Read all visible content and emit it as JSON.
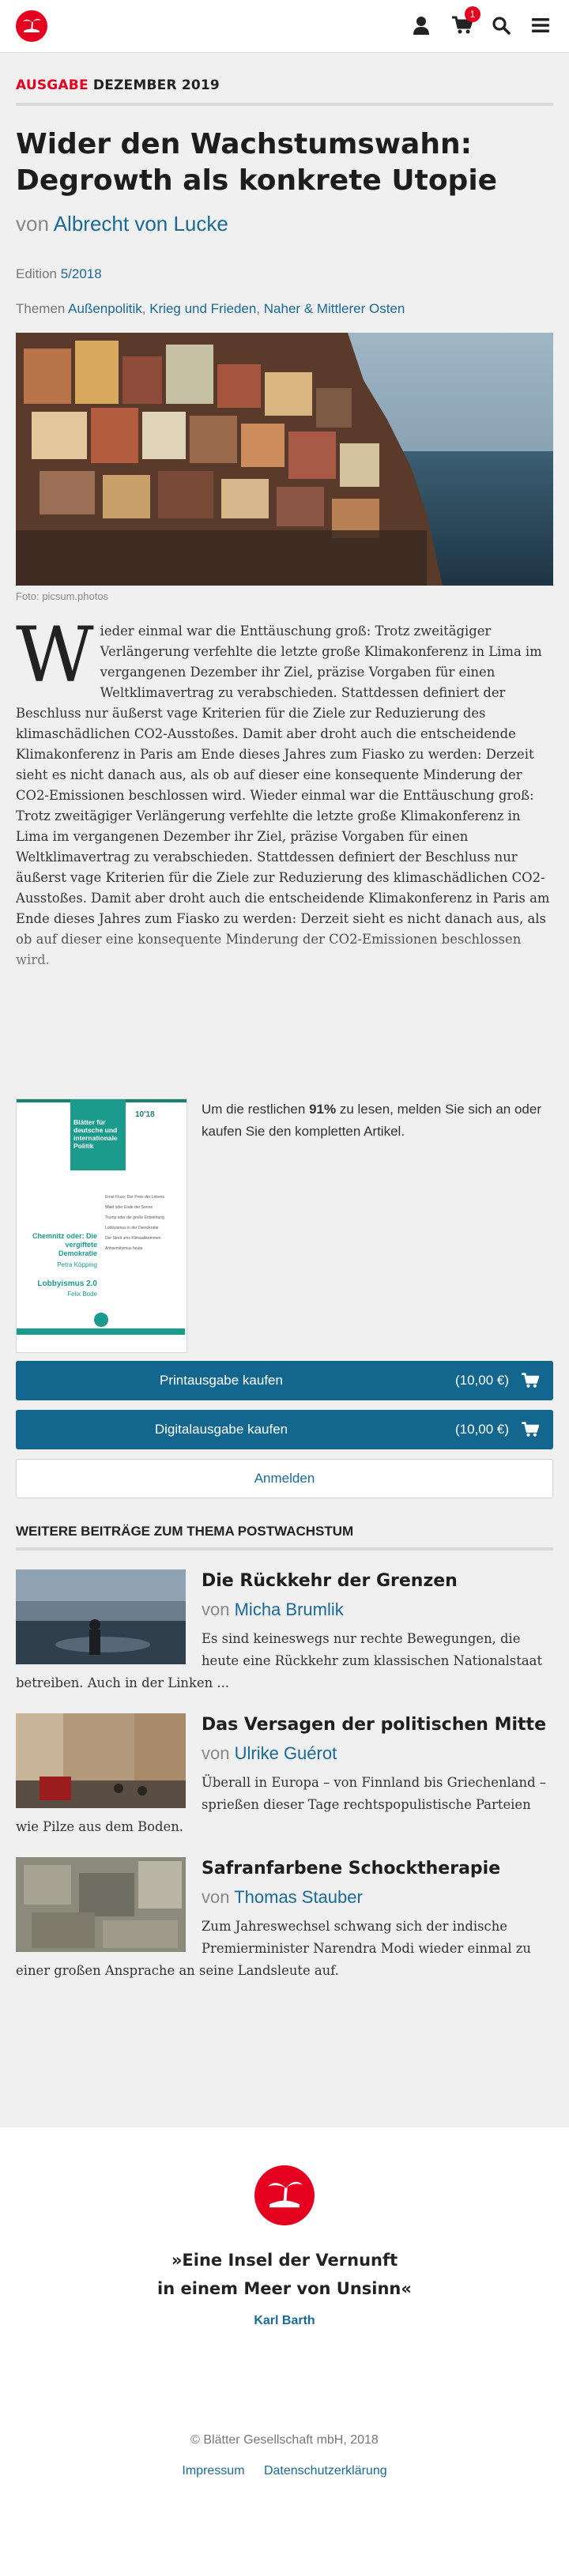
{
  "header": {
    "logo_icon": "island-logo-icon",
    "icons": [
      "user-icon",
      "cart-icon",
      "search-icon",
      "menu-icon"
    ],
    "cart_count": "1"
  },
  "article": {
    "kicker_red": "Ausgabe",
    "kicker_rest": "Dezember 2019",
    "title": "Wider den Wachstumswahn: Degrowth als konkrete Utopie",
    "author_prefix": "von",
    "author": "Albrecht von Lucke",
    "edition_label": "Edition",
    "edition_value": "5/2018",
    "themes_label": "Themen",
    "themes": [
      "Außenpolitik",
      "Krieg und Frieden",
      "Naher & Mittlerer Osten"
    ],
    "image_caption": "Foto: picsum.photos",
    "dropcap": "W",
    "body": "ieder einmal war die Enttäuschung groß: Trotz zweitägiger Verlängerung verfehlte die letzte große Klimakonferenz in Lima im vergangenen Dezember ihr Ziel, präzise Vorgaben für einen Weltklimavertrag zu verabschieden. Stattdessen definiert der Beschluss nur äußerst vage Kriterien für die Ziele zur Reduzierung des klimaschädlichen CO2-Ausstoßes. Damit aber droht auch die entscheidende Klimakonferenz in Paris am Ende dieses Jahres zum Fiasko zu werden: Derzeit sieht es nicht danach aus, als ob auf dieser eine konsequente Minderung der CO2-Emissionen beschlossen wird. Wieder einmal war die Enttäuschung groß: Trotz zweitägiger Verlängerung verfehlte die letzte große Klimakonferenz in Lima im vergangenen Dezember ihr Ziel, präzise Vorgaben für einen Weltklimavertrag zu verabschieden. Stattdessen definiert der Beschluss nur äußerst vage Kriterien für die Ziele zur Reduzierung des klimaschädlichen CO2-Ausstoßes. Damit aber droht auch die entscheidende Klimakonferenz in Paris am Ende dieses Jahres zum Fiasko zu werden: Derzeit sieht es nicht danach aus, als ob auf dieser eine konsequente Minderung der CO2-Emissionen beschlossen wird."
  },
  "paywall": {
    "text_pre": "Um die restlichen",
    "percent": "91%",
    "text_post": "zu lesen, melden Sie sich an oder kaufen Sie den kompletten Artikel.",
    "cover": {
      "title": "Blätter für deutsche und internationale Politik",
      "issue": "10'18",
      "toc": [
        "Ernst Fluss: Der Preis der Lebens",
        "Wald oder Ende der Sonne",
        "Trump oder die große Entwertung",
        "Lobbyismus in der Demokratie",
        "Der Streit ums Klimaabkommen",
        "Antisemitismus heute"
      ],
      "headline1": "Chemnitz oder: Die vergiftete Demokratie",
      "headline1_author": "Petra Köpping",
      "headline2": "Lobbyismus 2.0",
      "headline2_author": "Felix Bode"
    },
    "buy_print_label": "Printausgabe kaufen",
    "buy_print_price": "(10,00 €)",
    "buy_digital_label": "Digitalausgabe kaufen",
    "buy_digital_price": "(10,00 €)",
    "login_label": "Anmelden"
  },
  "related": {
    "heading": "Weitere Beiträge zum Thema Postwachstum",
    "items": [
      {
        "title": "Die Rückkehr der Grenzen",
        "author_prefix": "von",
        "author": "Micha Brumlik",
        "teaser": "Es sind keineswegs nur rechte Bewegungen, die heute eine Rückkehr zum klassischen Nationalstaat betreiben. Auch in der Linken ..."
      },
      {
        "title": "Das Versagen der politischen Mitte",
        "author_prefix": "von",
        "author": "Ulrike Guérot",
        "teaser": "Überall in Europa – von Finnland bis Griechenland – sprießen dieser Tage rechtspopulistische Parteien wie Pilze aus dem Boden."
      },
      {
        "title": "Safranfarbene Schocktherapie",
        "author_prefix": "von",
        "author": "Thomas Stauber",
        "teaser": "Zum Jahreswechsel schwang sich der indische Premierminister Narendra Modi wieder einmal zu einer großen Ansprache an seine Landsleute auf."
      }
    ]
  },
  "footer": {
    "quote_line1": "»Eine Insel der Vernunft",
    "quote_line2": "in einem Meer von Unsinn«",
    "quote_author": "Karl Barth",
    "copyright": "© Blätter Gesellschaft mbH, 2018",
    "links": [
      "Impressum",
      "Datenschutzerklärung"
    ]
  },
  "colors": {
    "brand_red": "#e5001f",
    "link_blue": "#1a6a96",
    "button_blue": "#13678f"
  }
}
